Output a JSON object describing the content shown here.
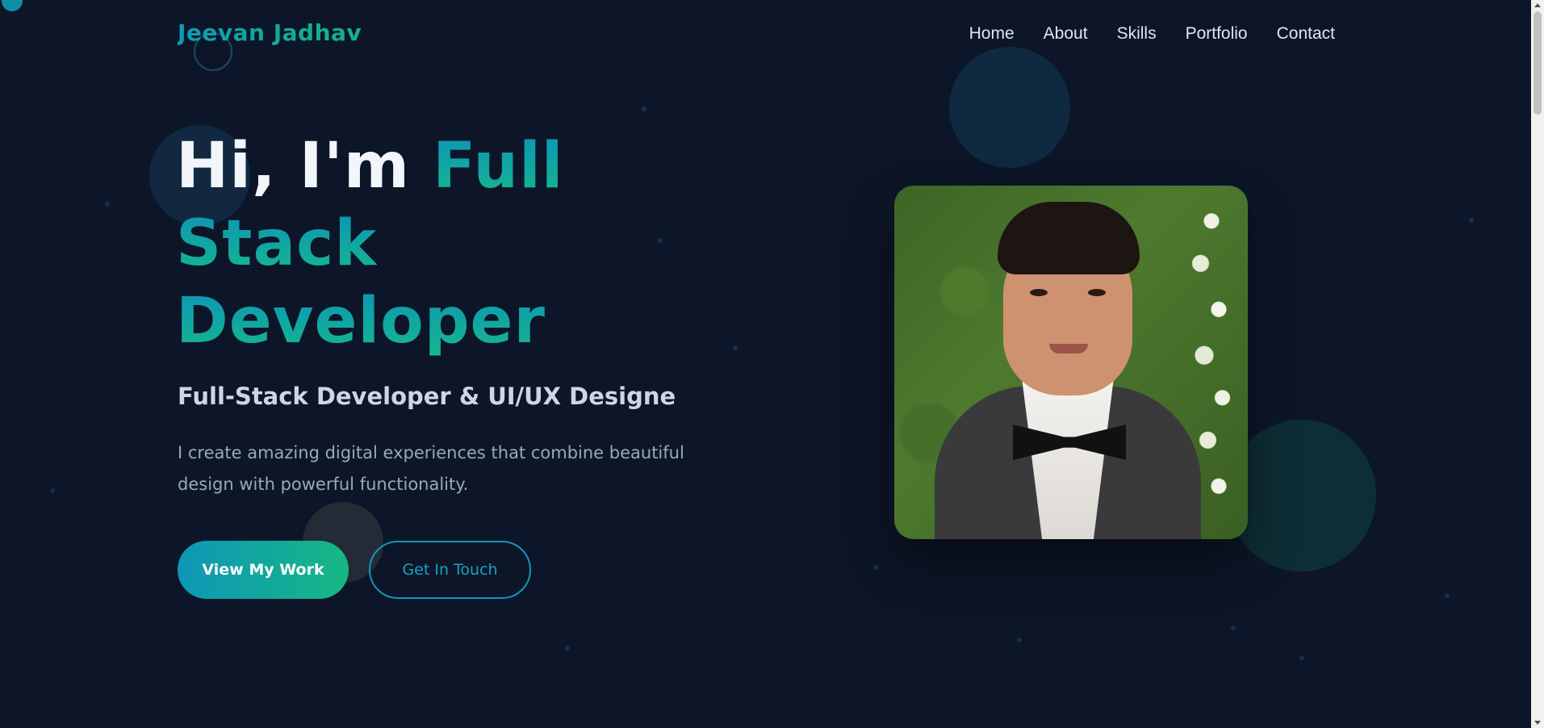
{
  "nav": {
    "logo": "Jeevan Jadhav",
    "links": [
      "Home",
      "About",
      "Skills",
      "Portfolio",
      "Contact"
    ]
  },
  "hero": {
    "title_plain": "Hi, I'm ",
    "title_accent_1": "Full",
    "title_accent_2": "Stack",
    "title_accent_3": "Developer",
    "subtitle": "Full-Stack Developer & UI/UX Designe",
    "description": "I create amazing digital experiences that combine beautiful design with powerful functionality.",
    "primary_button": "View My Work",
    "secondary_button": "Get In Touch"
  },
  "colors": {
    "background": "#0d1628",
    "accent_start": "#0e97b7",
    "accent_end": "#16b883"
  },
  "icons": {
    "profile": "profile-photo"
  }
}
